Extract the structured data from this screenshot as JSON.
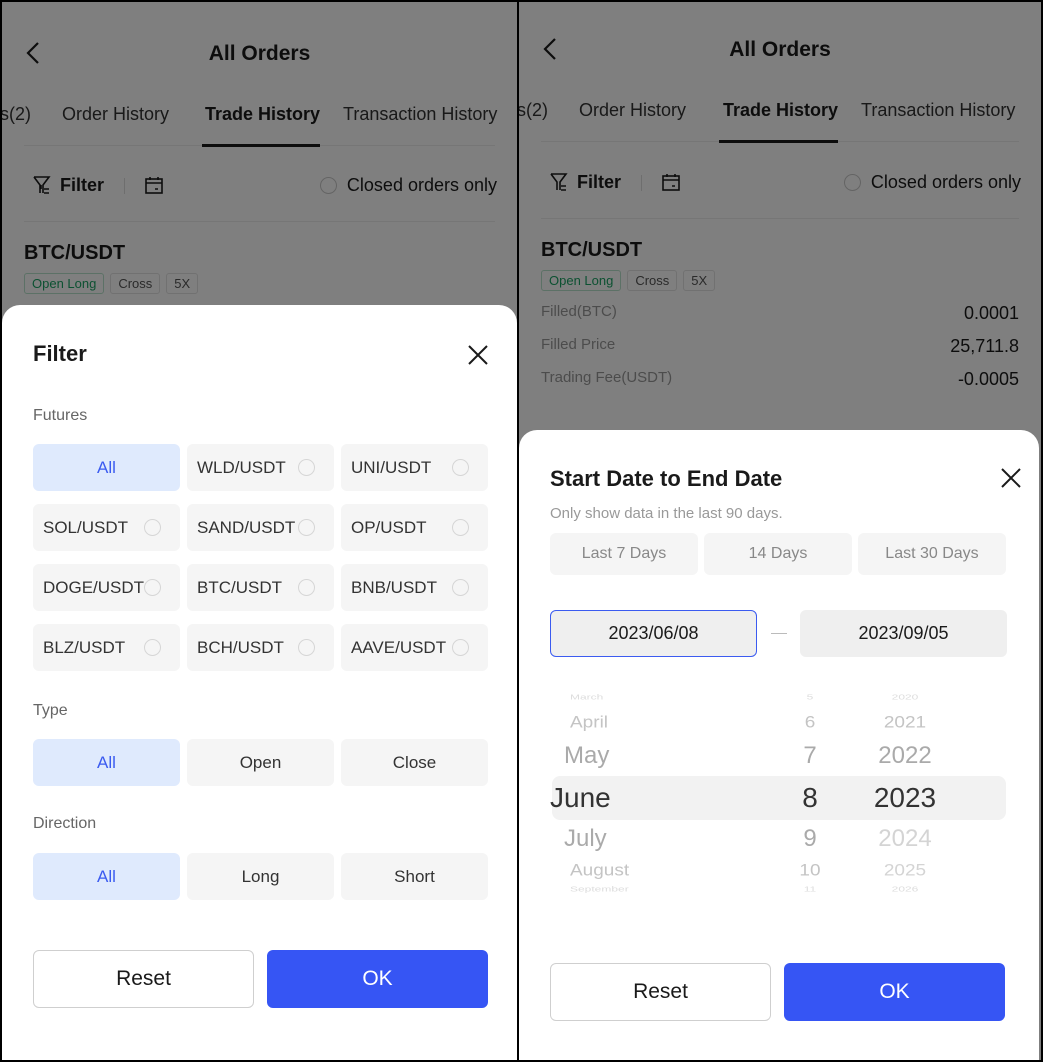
{
  "header": {
    "title": "All Orders",
    "tabs": [
      {
        "label": "s(2)"
      },
      {
        "label": "Order History"
      },
      {
        "label": "Trade History",
        "active": true
      },
      {
        "label": "Transaction History"
      }
    ]
  },
  "toolbar": {
    "filter_label": "Filter",
    "closed_orders_label": "Closed orders only"
  },
  "order": {
    "pair": "BTC/USDT",
    "tags": [
      "Open Long",
      "Cross",
      "5X"
    ],
    "fields": [
      {
        "label": "Filled(BTC)",
        "value": "0.0001"
      },
      {
        "label": "Filled Price",
        "value": "25,711.8"
      },
      {
        "label": "Trading Fee(USDT)",
        "value": "-0.0005"
      }
    ]
  },
  "filter_sheet": {
    "title": "Filter",
    "futures_label": "Futures",
    "futures": [
      "All",
      "WLD/USDT",
      "UNI/USDT",
      "SOL/USDT",
      "SAND/USDT",
      "OP/USDT",
      "DOGE/USDT",
      "BTC/USDT",
      "BNB/USDT",
      "BLZ/USDT",
      "BCH/USDT",
      "AAVE/USDT"
    ],
    "futures_selected": "All",
    "type_label": "Type",
    "types": [
      "All",
      "Open",
      "Close"
    ],
    "type_selected": "All",
    "direction_label": "Direction",
    "directions": [
      "All",
      "Long",
      "Short"
    ],
    "direction_selected": "All",
    "reset_label": "Reset",
    "ok_label": "OK"
  },
  "date_sheet": {
    "title": "Start Date to End Date",
    "subtitle": "Only show data in the last 90 days.",
    "quick_ranges": [
      "Last 7 Days",
      "14 Days",
      "Last 30 Days"
    ],
    "start_date": "2023/06/08",
    "end_date": "2023/09/05",
    "picker": {
      "months": [
        "March",
        "April",
        "May",
        "June",
        "July",
        "August",
        "September"
      ],
      "days": [
        "5",
        "6",
        "7",
        "8",
        "9",
        "10",
        "11"
      ],
      "years": [
        "2020",
        "2021",
        "2022",
        "2023",
        "2024",
        "2025",
        "2026"
      ],
      "selected": {
        "month": "June",
        "day": "8",
        "year": "2023"
      }
    },
    "reset_label": "Reset",
    "ok_label": "OK"
  },
  "colors": {
    "accent": "#3655f4",
    "selected_chip_bg": "#dfeafd",
    "selected_chip_text": "#3b5bf0",
    "positive_tag": "#1aa364",
    "annotation_arrow": "#ff3b1f"
  }
}
